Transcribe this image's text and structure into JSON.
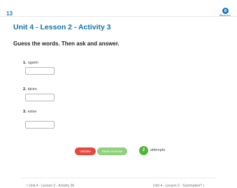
{
  "header": {
    "page_number": "13",
    "logo_text": "Pearson"
  },
  "activity": {
    "title": "Unit 4 - Lesson 2 - Activity 3",
    "instruction": "Guess the words. Then ask and answer."
  },
  "questions": [
    {
      "number": "1.",
      "scrambled": "ugami",
      "answer": ""
    },
    {
      "number": "2.",
      "scrambled": "tdcim",
      "answer": ""
    },
    {
      "number": "3.",
      "scrambled": "eslse",
      "answer": ""
    }
  ],
  "controls": {
    "validate_label": "Validate",
    "reset_label": "Reset exercise",
    "attempts_count": "2",
    "attempts_label": "attempts"
  },
  "navigation": {
    "prev_label": "Unit 4 - Lesson 2 - Activity 2b",
    "next_label": "Unit 4 - Lesson 2 - Summative?"
  },
  "colors": {
    "accent": "#0d73a8",
    "validate": "#e8473e",
    "reset": "#8fd17c",
    "attempts": "#4fb636"
  }
}
